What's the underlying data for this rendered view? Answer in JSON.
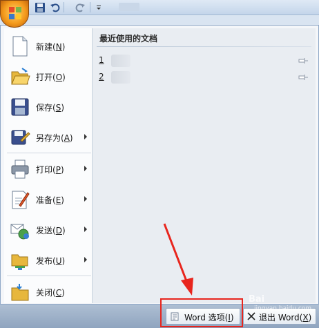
{
  "menu": {
    "items": [
      {
        "label": "新建",
        "key": "N",
        "icon": "new-document-icon",
        "submenu": false
      },
      {
        "label": "打开",
        "key": "O",
        "icon": "open-folder-icon",
        "submenu": false
      },
      {
        "label": "保存",
        "key": "S",
        "icon": "save-disk-icon",
        "submenu": false
      },
      {
        "label": "另存为",
        "key": "A",
        "icon": "save-as-icon",
        "submenu": true
      },
      {
        "label": "打印",
        "key": "P",
        "icon": "printer-icon",
        "submenu": true
      },
      {
        "label": "准备",
        "key": "E",
        "icon": "prepare-icon",
        "submenu": true
      },
      {
        "label": "发送",
        "key": "D",
        "icon": "send-icon",
        "submenu": true
      },
      {
        "label": "发布",
        "key": "U",
        "icon": "publish-icon",
        "submenu": true
      },
      {
        "label": "关闭",
        "key": "C",
        "icon": "close-folder-icon",
        "submenu": false
      }
    ]
  },
  "recent": {
    "title": "最近使用的文档",
    "items": [
      {
        "num": "1",
        "icon": "pin-icon"
      },
      {
        "num": "2",
        "icon": "pin-icon"
      }
    ]
  },
  "footer": {
    "options_label": "Word 选项",
    "options_key": "I",
    "exit_label": "退出 Word",
    "exit_key": "X"
  },
  "watermark": {
    "text": "Bai",
    "sub": "jingyan.baidu.com"
  },
  "colors": {
    "highlight": "#e8251d",
    "office_orange": "#f49a1c"
  }
}
